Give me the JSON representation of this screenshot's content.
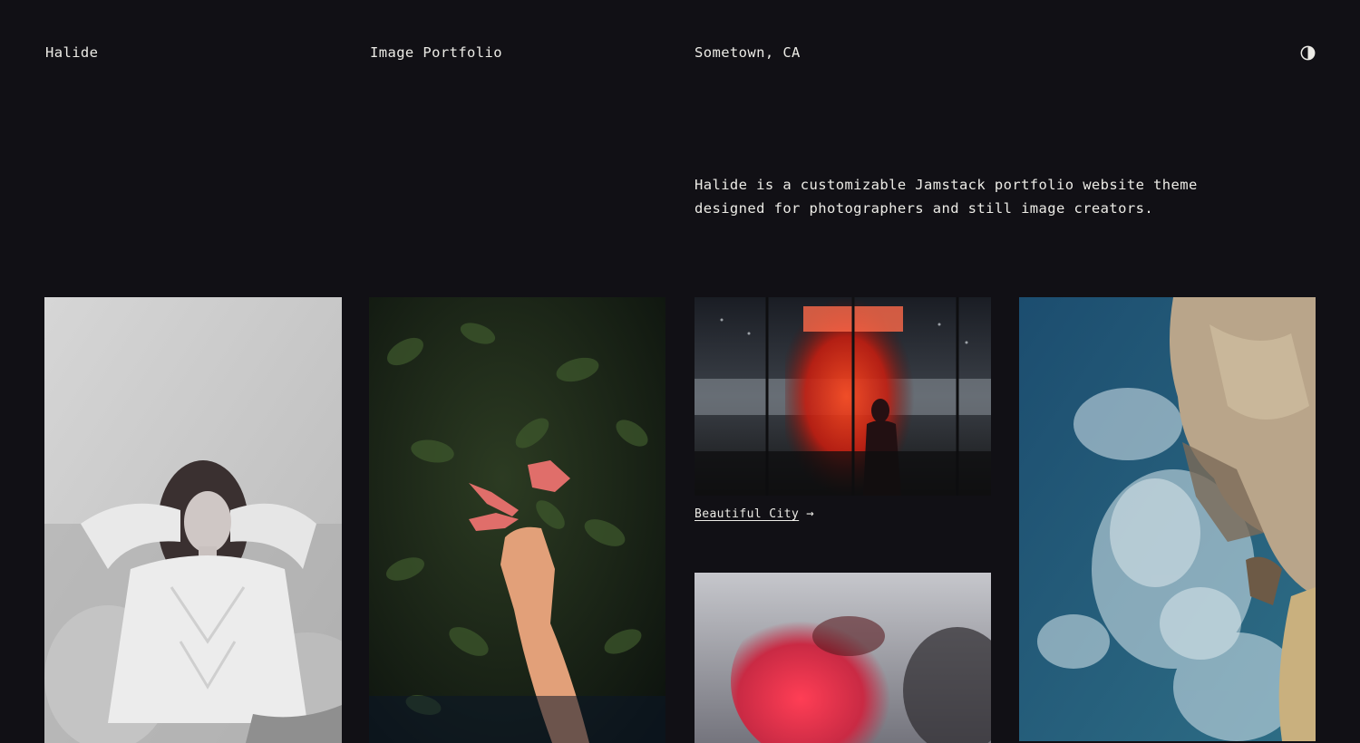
{
  "header": {
    "site_name": "Halide",
    "site_title": "Image Portfolio",
    "location": "Sometown, CA",
    "theme_toggle_icon": "contrast-half-circle-icon"
  },
  "intro": {
    "text": "Halide is a customizable Jamstack portfolio website theme designed for photographers and still image creators."
  },
  "gallery": {
    "items": [
      {
        "subject": "black and white portrait of a woman in a knit sweater"
      },
      {
        "subject": "hand reaching for pink trumpet flowers against dark foliage"
      },
      {
        "subject": "red lit glass window with silhouetted figure",
        "caption": "Beautiful City",
        "arrow": "→"
      },
      {
        "subject": "blurred face lit in red"
      },
      {
        "subject": "aerial view of waves crashing on rocky coast"
      }
    ]
  },
  "colors": {
    "background": "#111015",
    "text": "#ecebe6"
  }
}
